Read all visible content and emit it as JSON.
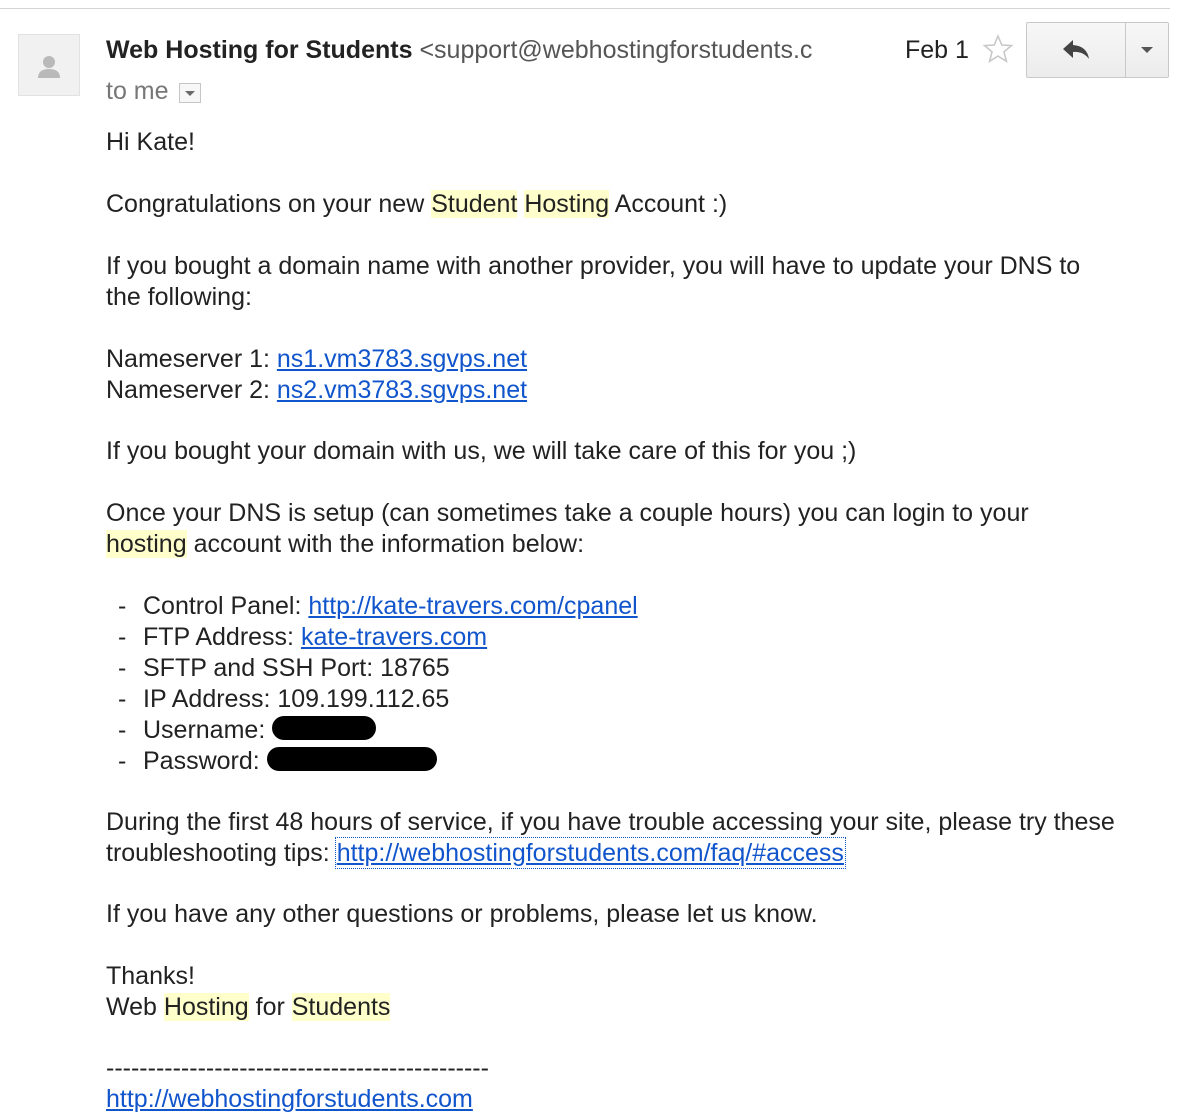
{
  "header": {
    "sender_name": "Web Hosting for Students",
    "sender_email": "<support@webhostingforstudents.c",
    "recipient": "to me",
    "date": "Feb 1"
  },
  "icons": {
    "avatar": "person-icon",
    "star": "star-outline-icon",
    "reply": "reply-arrow-icon",
    "more": "chevron-down-icon"
  },
  "colors": {
    "link": "#1155cc",
    "highlight": "#ffffcc",
    "text": "#222222"
  },
  "body": {
    "greeting": "Hi Kate!",
    "congrats_prefix": "Congratulations on your new ",
    "congrats_hl1": "Student",
    "congrats_hl2": "Hosting",
    "congrats_suffix": " Account :)",
    "dns_line1": "If you bought a domain name with another provider, you will have to update your DNS to",
    "dns_line2": "the following:",
    "ns1_label": "Nameserver 1: ",
    "ns1_value": "ns1.vm3783.sgvps.net",
    "ns2_label": "Nameserver 2: ",
    "ns2_value": "ns2.vm3783.sgvps.net",
    "care_line": "If you bought your domain with us, we will take care of this for you ;)",
    "once_line1": "Once your DNS is setup (can sometimes take a couple hours) you can login to your",
    "once_hl": "hosting",
    "once_line2_rest": " account with the information below:",
    "details": [
      {
        "dash": "-",
        "label": "Control Panel: ",
        "value": "http://kate-travers.com/cpanel",
        "link": true
      },
      {
        "dash": "-",
        "label": "FTP Address: ",
        "value": "kate-travers.com",
        "link": true
      },
      {
        "dash": "-",
        "label": "SFTP and SSH Port: 18765"
      },
      {
        "dash": "-",
        "label": "IP Address: 109.199.112.65"
      },
      {
        "dash": "-",
        "label": "Username: ",
        "redacted": true
      },
      {
        "dash": "-",
        "label": "Password: ",
        "redacted": true
      }
    ],
    "tips_line1": "During the first 48 hours of service, if you have trouble accessing your site, please try these",
    "tips_prefix": "troubleshooting tips: ",
    "tips_link": "http://webhostingforstudents.com/faq/#access",
    "questions_line": "If you have any other questions or problems, please let us know.",
    "thanks": "Thanks!",
    "sig_web": "Web ",
    "sig_hosting": "Hosting",
    "sig_for": " for ",
    "sig_students": "Students",
    "separator": "----------------------------------------------",
    "footer_link": "http://webhostingforstudents.com"
  }
}
